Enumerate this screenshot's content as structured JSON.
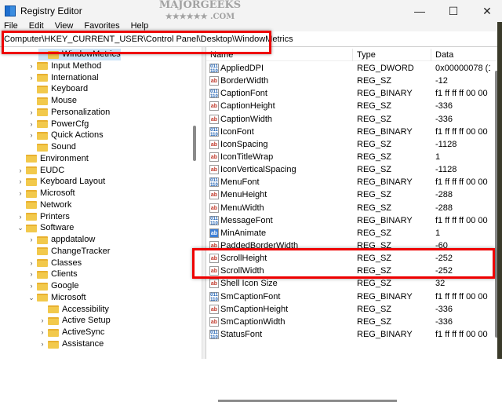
{
  "window": {
    "title": "Registry Editor",
    "minimize": "—",
    "maximize": "☐",
    "close": "✕"
  },
  "watermark": "MAJORGEEKS ★★★★★★ .COM",
  "menu": [
    "File",
    "Edit",
    "View",
    "Favorites",
    "Help"
  ],
  "address": "Computer\\HKEY_CURRENT_USER\\Control Panel\\Desktop\\WindowMetrics",
  "tree": [
    {
      "label": "WindowMetrics",
      "level": 3,
      "expander": "none",
      "selected": true
    },
    {
      "label": "Input Method",
      "level": 2,
      "expander": "collapsed"
    },
    {
      "label": "International",
      "level": 2,
      "expander": "collapsed"
    },
    {
      "label": "Keyboard",
      "level": 2,
      "expander": "none"
    },
    {
      "label": "Mouse",
      "level": 2,
      "expander": "none"
    },
    {
      "label": "Personalization",
      "level": 2,
      "expander": "collapsed"
    },
    {
      "label": "PowerCfg",
      "level": 2,
      "expander": "collapsed"
    },
    {
      "label": "Quick Actions",
      "level": 2,
      "expander": "collapsed"
    },
    {
      "label": "Sound",
      "level": 2,
      "expander": "none"
    },
    {
      "label": "Environment",
      "level": 1,
      "expander": "none"
    },
    {
      "label": "EUDC",
      "level": 1,
      "expander": "collapsed"
    },
    {
      "label": "Keyboard Layout",
      "level": 1,
      "expander": "collapsed"
    },
    {
      "label": "Microsoft",
      "level": 1,
      "expander": "collapsed"
    },
    {
      "label": "Network",
      "level": 1,
      "expander": "none"
    },
    {
      "label": "Printers",
      "level": 1,
      "expander": "collapsed"
    },
    {
      "label": "Software",
      "level": 1,
      "expander": "expanded"
    },
    {
      "label": "appdatalow",
      "level": 2,
      "expander": "collapsed"
    },
    {
      "label": "ChangeTracker",
      "level": 2,
      "expander": "none"
    },
    {
      "label": "Classes",
      "level": 2,
      "expander": "collapsed"
    },
    {
      "label": "Clients",
      "level": 2,
      "expander": "collapsed"
    },
    {
      "label": "Google",
      "level": 2,
      "expander": "collapsed"
    },
    {
      "label": "Microsoft",
      "level": 2,
      "expander": "expanded"
    },
    {
      "label": "Accessibility",
      "level": 3,
      "expander": "none"
    },
    {
      "label": "Active Setup",
      "level": 3,
      "expander": "collapsed"
    },
    {
      "label": "ActiveSync",
      "level": 3,
      "expander": "collapsed"
    },
    {
      "label": "Assistance",
      "level": 3,
      "expander": "collapsed"
    }
  ],
  "columns": {
    "name": "Name",
    "type": "Type",
    "data": "Data"
  },
  "values": [
    {
      "name": "AppliedDPI",
      "type": "REG_DWORD",
      "data": "0x00000078 (12",
      "icon": "bin"
    },
    {
      "name": "BorderWidth",
      "type": "REG_SZ",
      "data": "-12",
      "icon": "sz"
    },
    {
      "name": "CaptionFont",
      "type": "REG_BINARY",
      "data": "f1 ff ff ff 00 00 0",
      "icon": "bin"
    },
    {
      "name": "CaptionHeight",
      "type": "REG_SZ",
      "data": "-336",
      "icon": "sz"
    },
    {
      "name": "CaptionWidth",
      "type": "REG_SZ",
      "data": "-336",
      "icon": "sz"
    },
    {
      "name": "IconFont",
      "type": "REG_BINARY",
      "data": "f1 ff ff ff 00 00 0",
      "icon": "bin"
    },
    {
      "name": "IconSpacing",
      "type": "REG_SZ",
      "data": "-1128",
      "icon": "sz"
    },
    {
      "name": "IconTitleWrap",
      "type": "REG_SZ",
      "data": "1",
      "icon": "sz"
    },
    {
      "name": "IconVerticalSpacing",
      "type": "REG_SZ",
      "data": "-1128",
      "icon": "sz"
    },
    {
      "name": "MenuFont",
      "type": "REG_BINARY",
      "data": "f1 ff ff ff 00 00 0",
      "icon": "bin"
    },
    {
      "name": "MenuHeight",
      "type": "REG_SZ",
      "data": "-288",
      "icon": "sz"
    },
    {
      "name": "MenuWidth",
      "type": "REG_SZ",
      "data": "-288",
      "icon": "sz"
    },
    {
      "name": "MessageFont",
      "type": "REG_BINARY",
      "data": "f1 ff ff ff 00 00 0",
      "icon": "bin"
    },
    {
      "name": "MinAnimate",
      "type": "REG_SZ",
      "data": "1",
      "icon": "szb"
    },
    {
      "name": "PaddedBorderWidth",
      "type": "REG_SZ",
      "data": "-60",
      "icon": "sz"
    },
    {
      "name": "ScrollHeight",
      "type": "REG_SZ",
      "data": "-252",
      "icon": "sz"
    },
    {
      "name": "ScrollWidth",
      "type": "REG_SZ",
      "data": "-252",
      "icon": "sz"
    },
    {
      "name": "Shell Icon Size",
      "type": "REG_SZ",
      "data": "32",
      "icon": "sz"
    },
    {
      "name": "SmCaptionFont",
      "type": "REG_BINARY",
      "data": "f1 ff ff ff 00 00 0",
      "icon": "bin"
    },
    {
      "name": "SmCaptionHeight",
      "type": "REG_SZ",
      "data": "-336",
      "icon": "sz"
    },
    {
      "name": "SmCaptionWidth",
      "type": "REG_SZ",
      "data": "-336",
      "icon": "sz"
    },
    {
      "name": "StatusFont",
      "type": "REG_BINARY",
      "data": "f1 ff ff ff 00 00 0",
      "icon": "bin"
    }
  ],
  "highlight_color": "#e00000"
}
